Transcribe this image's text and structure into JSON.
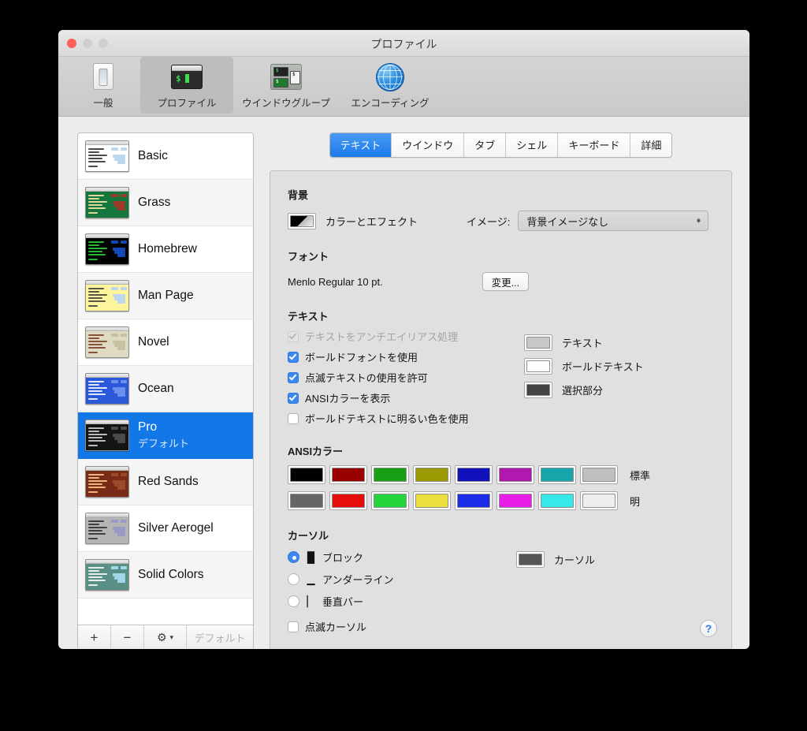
{
  "window": {
    "title": "プロファイル"
  },
  "toolbar": {
    "items": [
      {
        "label": "一般",
        "icon": "general-icon"
      },
      {
        "label": "プロファイル",
        "icon": "terminal-icon"
      },
      {
        "label": "ウインドウグループ",
        "icon": "window-group-icon"
      },
      {
        "label": "エンコーディング",
        "icon": "globe-icon"
      }
    ],
    "selected": "プロファイル"
  },
  "sidebar": {
    "profiles": [
      {
        "name": "Basic",
        "subtitle": "",
        "bg": "#ffffff",
        "fg": "#2a2a2a",
        "accent": "#bcd8f0"
      },
      {
        "name": "Grass",
        "subtitle": "",
        "bg": "#13773d",
        "fg": "#ffe9a8",
        "accent": "#9d3b2a"
      },
      {
        "name": "Homebrew",
        "subtitle": "",
        "bg": "#000000",
        "fg": "#2fd642",
        "accent": "#1348b8"
      },
      {
        "name": "Man Page",
        "subtitle": "",
        "bg": "#fef49c",
        "fg": "#3a3a3a",
        "accent": "#bcd8f0"
      },
      {
        "name": "Novel",
        "subtitle": "",
        "bg": "#dfdbc3",
        "fg": "#7a3b21",
        "accent": "#c8c0a2"
      },
      {
        "name": "Ocean",
        "subtitle": "",
        "bg": "#2b58d8",
        "fg": "#ffffff",
        "accent": "#6d90ee"
      },
      {
        "name": "Pro",
        "subtitle": "デフォルト",
        "bg": "#141414",
        "fg": "#d8d8d8",
        "accent": "#4a4a4a"
      },
      {
        "name": "Red Sands",
        "subtitle": "",
        "bg": "#7a2b18",
        "fg": "#ffcf8f",
        "accent": "#9d4a2a"
      },
      {
        "name": "Silver Aerogel",
        "subtitle": "",
        "bg": "#b4b4b4",
        "fg": "#2a2a2a",
        "accent": "#9a9ac4"
      },
      {
        "name": "Solid Colors",
        "subtitle": "",
        "bg": "#5a8f85",
        "fg": "#ffffff",
        "accent": "#9fd8ea"
      }
    ],
    "selected_index": 6,
    "bottom": {
      "add_label": "+",
      "remove_label": "−",
      "gear_label": "✿",
      "gear_chevron": "⌄",
      "default_label": "デフォルト"
    }
  },
  "tabs": {
    "items": [
      "テキスト",
      "ウインドウ",
      "タブ",
      "シェル",
      "キーボード",
      "詳細"
    ],
    "selected": "テキスト"
  },
  "background": {
    "section_title": "背景",
    "color_effects_label": "カラーとエフェクト",
    "image_label": "イメージ:",
    "image_value": "背景イメージなし"
  },
  "font": {
    "section_title": "フォント",
    "current": "Menlo Regular 10 pt.",
    "change_button": "変更..."
  },
  "text": {
    "section_title": "テキスト",
    "options": [
      {
        "label": "テキストをアンチエイリアス処理",
        "checked": true,
        "disabled": true
      },
      {
        "label": "ボールドフォントを使用",
        "checked": true,
        "disabled": false
      },
      {
        "label": "点滅テキストの使用を許可",
        "checked": true,
        "disabled": false
      },
      {
        "label": "ANSIカラーを表示",
        "checked": true,
        "disabled": false
      },
      {
        "label": "ボールドテキストに明るい色を使用",
        "checked": false,
        "disabled": false
      }
    ],
    "colors": [
      {
        "label": "テキスト",
        "color": "#c8c8c8"
      },
      {
        "label": "ボールドテキスト",
        "color": "#ffffff"
      },
      {
        "label": "選択部分",
        "color": "#444444"
      }
    ]
  },
  "ansi": {
    "section_title": "ANSIカラー",
    "normal_label": "標準",
    "bright_label": "明",
    "normal": [
      "#000000",
      "#990000",
      "#15a015",
      "#999900",
      "#1111bb",
      "#b018b0",
      "#17a5ac",
      "#bfbfbf"
    ],
    "bright": [
      "#666666",
      "#e60d0d",
      "#23d53a",
      "#ecdf3f",
      "#1b2de8",
      "#e81ee8",
      "#36e8e8",
      "#eeeeee"
    ]
  },
  "cursor": {
    "section_title": "カーソル",
    "options": [
      {
        "label": "ブロック",
        "glyph": "█",
        "selected": true
      },
      {
        "label": "アンダーライン",
        "glyph": "▁",
        "selected": false
      },
      {
        "label": "垂直バー",
        "glyph": "▏",
        "selected": false
      }
    ],
    "blink_label": "点滅カーソル",
    "blink_checked": false,
    "color_label": "カーソル",
    "color": "#555555"
  },
  "help": {
    "label": "?"
  }
}
